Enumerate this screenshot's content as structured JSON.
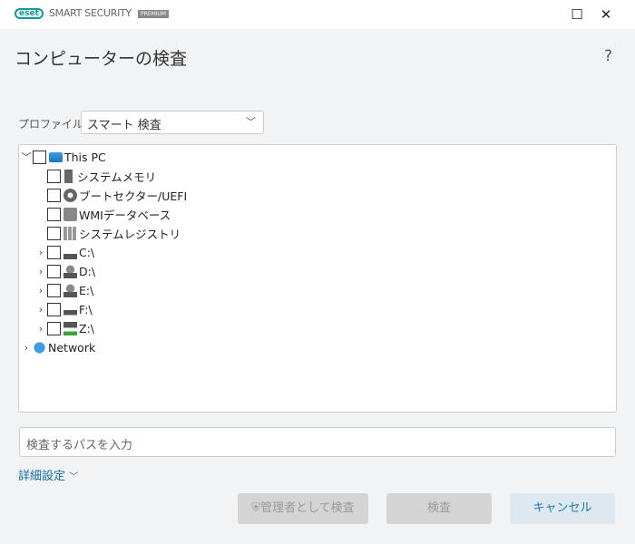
{
  "app": {
    "logo": "eset",
    "brand": "SMART SECURITY",
    "edition": "PREMIUM"
  },
  "window": {
    "maximize": "☐",
    "close": "✕"
  },
  "page_title": "コンピューターの検査",
  "help": "?",
  "profile": {
    "label": "プロファイル",
    "value": "スマート 検査"
  },
  "tree": [
    {
      "label": "This PC",
      "icon": "computer-icon",
      "level": 0,
      "expander": "﹀"
    },
    {
      "label": "システムメモリ",
      "icon": "memory-icon",
      "level": 1
    },
    {
      "label": "ブートセクター/UEFI",
      "icon": "disc-icon",
      "level": 1
    },
    {
      "label": "WMIデータベース",
      "icon": "wmi-icon",
      "level": 1
    },
    {
      "label": "システムレジストリ",
      "icon": "registry-icon",
      "level": 1
    },
    {
      "label": "C:\\",
      "icon": "system-drive-icon",
      "level": 1,
      "expander": "›"
    },
    {
      "label": "D:\\",
      "icon": "optical-drive-icon",
      "level": 1,
      "expander": "›"
    },
    {
      "label": "E:\\",
      "icon": "optical-drive-icon",
      "level": 1,
      "expander": "›"
    },
    {
      "label": "F:\\",
      "icon": "drive-icon",
      "level": 1,
      "expander": "›"
    },
    {
      "label": "Z:\\",
      "icon": "network-drive-icon",
      "level": 1,
      "expander": "›"
    },
    {
      "label": "Network",
      "icon": "network-icon",
      "level": 0,
      "expander": "›"
    }
  ],
  "path_placeholder": "検査するパスを入力",
  "advanced": "詳細設定",
  "buttons": {
    "admin_scan": "管理者として検査",
    "scan": "検査",
    "cancel": "キャンセル"
  }
}
